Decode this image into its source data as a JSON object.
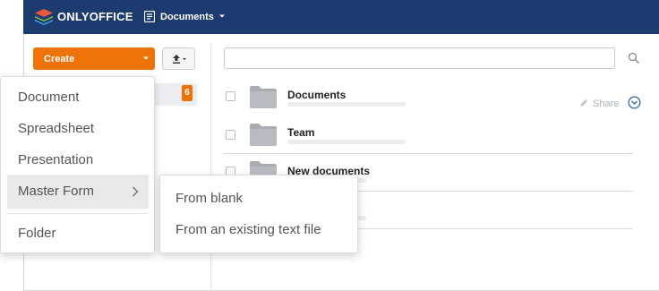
{
  "header": {
    "brand": "ONLYOFFICE",
    "nav_label": "Documents"
  },
  "toolbar": {
    "create_label": "Create"
  },
  "sidebar": {
    "badge_count": "6"
  },
  "search": {
    "placeholder": ""
  },
  "files": [
    {
      "name": "Documents"
    },
    {
      "name": "Team"
    },
    {
      "name": "New documents"
    }
  ],
  "row_actions": {
    "share_label": "Share"
  },
  "create_menu": {
    "items": [
      "Document",
      "Spreadsheet",
      "Presentation",
      "Master Form",
      "Folder"
    ]
  },
  "master_form_submenu": {
    "items": [
      "From blank",
      "From an existing text file"
    ]
  },
  "colors": {
    "header_bg": "#1d3b6e",
    "accent": "#ed7309"
  },
  "icons": [
    "onlyoffice-logo-icon",
    "document-icon",
    "chevron-down-icon",
    "upload-icon",
    "search-icon",
    "folder-icon",
    "share-icon",
    "more-icon",
    "chevron-right-icon"
  ]
}
